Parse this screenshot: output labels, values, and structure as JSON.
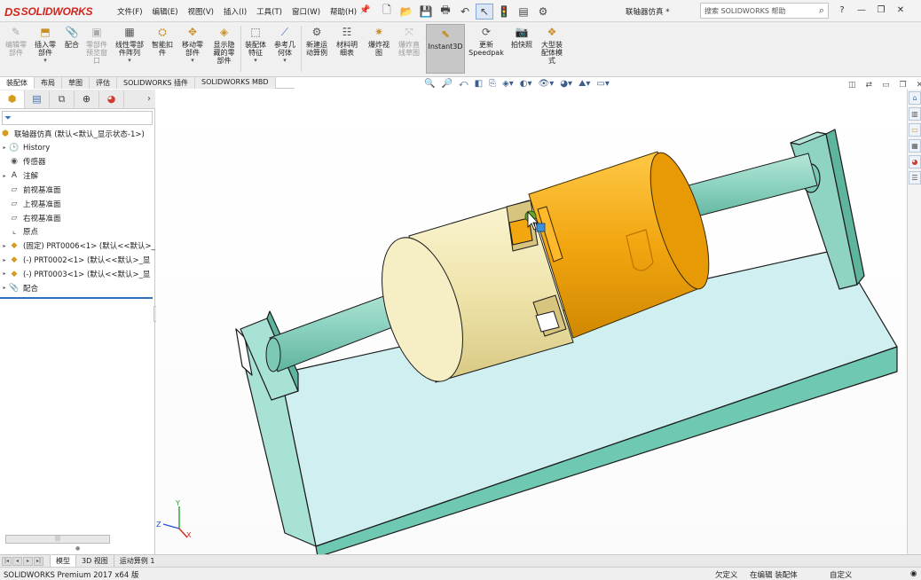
{
  "app": {
    "brand_prefix": "DS",
    "brand": "SOLIDWORKS",
    "document_title": "联轴器仿真 *"
  },
  "menus": [
    "文件(F)",
    "编辑(E)",
    "视图(V)",
    "插入(I)",
    "工具(T)",
    "窗口(W)",
    "帮助(H)"
  ],
  "quick_access": [
    "new-icon",
    "open-icon",
    "save-icon",
    "print-icon",
    "undo-icon",
    "select-icon",
    "rebuild-icon",
    "file-properties-icon",
    "options-icon"
  ],
  "help_search": {
    "placeholder": "搜索 SOLIDWORKS 帮助"
  },
  "window_controls": [
    "help-icon",
    "minimize-icon",
    "restore-icon",
    "close-icon"
  ],
  "ribbon": {
    "buttons": [
      {
        "label": "编辑零\n部件",
        "icon": "edit-component-icon",
        "enabled": false
      },
      {
        "label": "插入零\n部件",
        "icon": "insert-component-icon",
        "enabled": true,
        "dropdown": true
      },
      {
        "label": "配合",
        "icon": "mate-icon",
        "enabled": true
      },
      {
        "label": "零部件\n预览窗\n口",
        "icon": "component-preview-icon",
        "enabled": false
      },
      {
        "label": "线性零部\n件阵列",
        "icon": "linear-pattern-icon",
        "enabled": true,
        "dropdown": true
      },
      {
        "label": "智能扣\n件",
        "icon": "smart-fasteners-icon",
        "enabled": true
      },
      {
        "label": "移动零\n部件",
        "icon": "move-component-icon",
        "enabled": true,
        "dropdown": true
      },
      {
        "label": "显示隐\n藏的零\n部件",
        "icon": "show-hidden-icon",
        "enabled": true
      },
      {
        "label": "装配体\n特征",
        "icon": "assembly-features-icon",
        "enabled": true,
        "dropdown": true
      },
      {
        "label": "参考几\n何体",
        "icon": "reference-geometry-icon",
        "enabled": true,
        "dropdown": true
      },
      {
        "label": "新建运\n动算例",
        "icon": "new-motion-study-icon",
        "enabled": true
      },
      {
        "label": "材料明\n细表",
        "icon": "bom-icon",
        "enabled": true
      },
      {
        "label": "爆炸视\n图",
        "icon": "exploded-view-icon",
        "enabled": true
      },
      {
        "label": "爆炸直\n线草图",
        "icon": "explode-line-sketch-icon",
        "enabled": false
      },
      {
        "label": "Instant3D",
        "icon": "instant3d-icon",
        "enabled": true,
        "active": true
      },
      {
        "label": "更新\nSpeedpak",
        "icon": "update-speedpak-icon",
        "enabled": true
      },
      {
        "label": "拍快照",
        "icon": "snapshot-icon",
        "enabled": true
      },
      {
        "label": "大型装\n配体模\n式",
        "icon": "large-assembly-mode-icon",
        "enabled": true
      }
    ]
  },
  "command_tabs": [
    {
      "label": "装配体",
      "active": true
    },
    {
      "label": "布局",
      "active": false
    },
    {
      "label": "草图",
      "active": false
    },
    {
      "label": "评估",
      "active": false
    },
    {
      "label": "SOLIDWORKS 插件",
      "active": false
    },
    {
      "label": "SOLIDWORKS MBD",
      "active": false
    }
  ],
  "heads_up_toolbar": [
    "zoom-to-fit-icon",
    "zoom-to-area-icon",
    "previous-view-icon",
    "section-view-icon",
    "dynamic-annotation-icon",
    "view-orientation-icon",
    "display-style-icon",
    "hide-show-items-icon",
    "edit-appearance-icon",
    "apply-scene-icon",
    "view-settings-icon"
  ],
  "feature_tree": {
    "tabs": [
      "featuremanager-icon",
      "propertymanager-icon",
      "configurationmanager-icon",
      "dimxpert-icon",
      "display-manager-icon"
    ],
    "root": "联轴器仿真  (默认<默认_显示状态-1>)",
    "items": [
      {
        "label": "History",
        "icon": "history-icon",
        "expandable": true
      },
      {
        "label": "传感器",
        "icon": "sensor-icon",
        "expandable": false
      },
      {
        "label": "注解",
        "icon": "annotation-icon",
        "expandable": true
      },
      {
        "label": "前视基准面",
        "icon": "plane-icon",
        "expandable": false
      },
      {
        "label": "上视基准面",
        "icon": "plane-icon",
        "expandable": false
      },
      {
        "label": "右视基准面",
        "icon": "plane-icon",
        "expandable": false
      },
      {
        "label": "原点",
        "icon": "origin-icon",
        "expandable": false
      },
      {
        "label": "(固定) PRT0006<1> (默认<<默认>_",
        "icon": "part-icon",
        "expandable": true
      },
      {
        "label": "(-) PRT0002<1> (默认<<默认>_显",
        "icon": "part-icon",
        "expandable": true
      },
      {
        "label": "(-) PRT0003<1> (默认<<默认>_显",
        "icon": "part-icon",
        "expandable": true
      },
      {
        "label": "配合",
        "icon": "mates-icon",
        "expandable": true
      }
    ]
  },
  "viewport": {
    "background": "#ffffff",
    "base_color": "#cfeff0",
    "base_edge": "#1a1a1a",
    "shaft_color": "#8fd4c2",
    "hub_left_color": "#f1e7b0",
    "hub_right_color": "#f2a610",
    "triad_labels": [
      "X",
      "Y",
      "Z"
    ]
  },
  "task_pane": [
    "solidworks-resources-icon",
    "design-library-icon",
    "file-explorer-icon",
    "view-palette-icon",
    "appearances-icon",
    "custom-properties-icon"
  ],
  "model_tabs": [
    {
      "label": "模型",
      "active": true
    },
    {
      "label": "3D 视图",
      "active": false
    },
    {
      "label": "运动算例 1",
      "active": false
    }
  ],
  "status_bar": {
    "product": "SOLIDWORKS Premium 2017 x64 版",
    "status1": "欠定义",
    "status2": "在编辑 装配体",
    "units": "自定义"
  }
}
